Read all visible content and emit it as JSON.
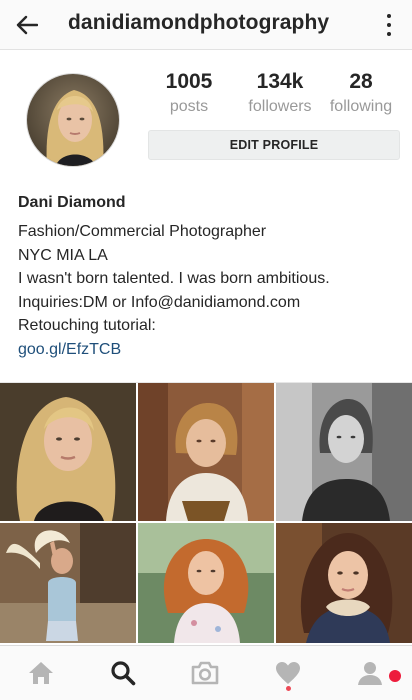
{
  "header": {
    "username": "danidiamondphotography",
    "back_icon": "arrow-left-icon",
    "more_icon": "vertical-dots-icon"
  },
  "profile": {
    "stats": [
      {
        "value": "1005",
        "label": "posts"
      },
      {
        "value": "134k",
        "label": "followers"
      },
      {
        "value": "28",
        "label": "following"
      }
    ],
    "edit_profile_label": "EDIT PROFILE"
  },
  "bio": {
    "name": "Dani Diamond",
    "lines": [
      "Fashion/Commercial Photographer",
      "NYC MIA LA",
      "I wasn't born talented. I was born ambitious.",
      "Inquiries:DM or Info@danidiamond.com",
      "Retouching tutorial:"
    ],
    "link": "goo.gl/EfzTCB"
  },
  "grid": {
    "columns": 3,
    "photos": [
      "photo-1",
      "photo-2",
      "photo-3",
      "photo-4",
      "photo-5",
      "photo-6"
    ]
  },
  "bottom_nav": {
    "items": [
      "home-icon",
      "search-icon",
      "camera-icon",
      "heart-icon",
      "profile-icon"
    ],
    "active": "search-icon"
  },
  "colors": {
    "link": "#1f4f7a",
    "notification": "#ed1c3c",
    "muted_label": "#999999",
    "button_bg": "#eef0f0"
  }
}
